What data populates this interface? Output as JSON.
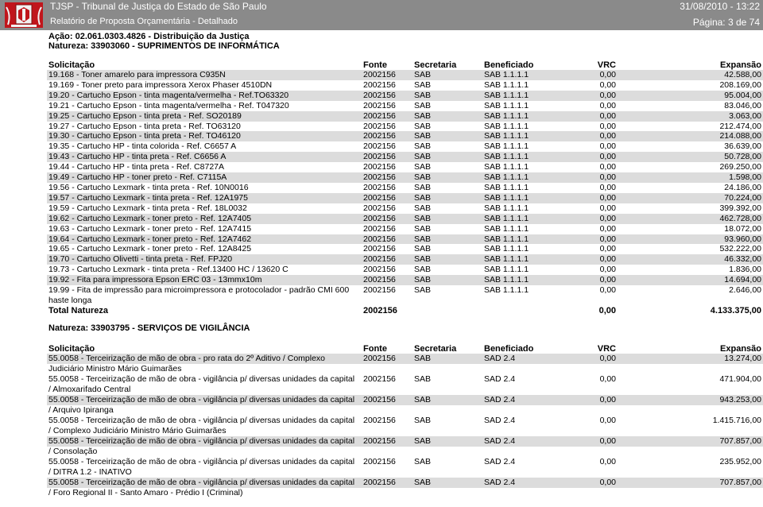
{
  "header": {
    "title": "TJSP - Tribunal de Justiça do Estado de São Paulo",
    "subtitle": "Relatório de Proposta Orçamentária - Detalhado",
    "datetime": "31/08/2010 - 13:22",
    "page": "Página: 3 de 74"
  },
  "acao": "Ação: 02.061.0303.4826 - Distribuição da Justiça",
  "section1": {
    "natureza": "Natureza: 33903060 - SUPRIMENTOS DE INFORMÁTICA",
    "columns": [
      "Solicitação",
      "Fonte",
      "Secretaria",
      "Beneficiado",
      "VRC",
      "Expansão"
    ],
    "rows": [
      [
        "19.168 - Toner amarelo para impressora C935N",
        "2002156",
        "SAB",
        "SAB 1.1.1.1",
        "0,00",
        "42.588,00"
      ],
      [
        "19.169 - Toner preto para impressora Xerox Phaser 4510DN",
        "2002156",
        "SAB",
        "SAB 1.1.1.1",
        "0,00",
        "208.169,00"
      ],
      [
        "19.20 - Cartucho Epson - tinta magenta/vermelha - Ref.TO63320",
        "2002156",
        "SAB",
        "SAB 1.1.1.1",
        "0,00",
        "95.004,00"
      ],
      [
        "19.21 - Cartucho Epson - tinta magenta/vermelha - Ref. T047320",
        "2002156",
        "SAB",
        "SAB 1.1.1.1",
        "0,00",
        "83.046,00"
      ],
      [
        "19.25 - Cartucho Epson - tinta preta - Ref. SO20189",
        "2002156",
        "SAB",
        "SAB 1.1.1.1",
        "0,00",
        "3.063,00"
      ],
      [
        "19.27 - Cartucho Epson - tinta preta - Ref. TO63120",
        "2002156",
        "SAB",
        "SAB 1.1.1.1",
        "0,00",
        "212.474,00"
      ],
      [
        "19.30 - Cartucho Epson - tinta preta - Ref. TO46120",
        "2002156",
        "SAB",
        "SAB 1.1.1.1",
        "0,00",
        "214.088,00"
      ],
      [
        "19.35 - Cartucho HP - tinta colorida - Ref. C6657 A",
        "2002156",
        "SAB",
        "SAB 1.1.1.1",
        "0,00",
        "36.639,00"
      ],
      [
        "19.43 - Cartucho HP - tinta preta - Ref. C6656 A",
        "2002156",
        "SAB",
        "SAB 1.1.1.1",
        "0,00",
        "50.728,00"
      ],
      [
        "19.44 - Cartucho HP - tinta preta - Ref. C8727A",
        "2002156",
        "SAB",
        "SAB 1.1.1.1",
        "0,00",
        "269.250,00"
      ],
      [
        "19.49 - Cartucho HP - toner preto - Ref. C7115A",
        "2002156",
        "SAB",
        "SAB 1.1.1.1",
        "0,00",
        "1.598,00"
      ],
      [
        "19.56 - Cartucho Lexmark - tinta preta - Ref. 10N0016",
        "2002156",
        "SAB",
        "SAB 1.1.1.1",
        "0,00",
        "24.186,00"
      ],
      [
        "19.57 - Cartucho Lexmark - tinta preta - Ref. 12A1975",
        "2002156",
        "SAB",
        "SAB 1.1.1.1",
        "0,00",
        "70.224,00"
      ],
      [
        "19.59 - Cartucho Lexmark - tinta preta - Ref. 18L0032",
        "2002156",
        "SAB",
        "SAB 1.1.1.1",
        "0,00",
        "399.392,00"
      ],
      [
        "19.62 - Cartucho Lexmark - toner preto - Ref. 12A7405",
        "2002156",
        "SAB",
        "SAB 1.1.1.1",
        "0,00",
        "462.728,00"
      ],
      [
        "19.63 - Cartucho Lexmark - toner preto - Ref. 12A7415",
        "2002156",
        "SAB",
        "SAB 1.1.1.1",
        "0,00",
        "18.072,00"
      ],
      [
        "19.64 - Cartucho Lexmark - toner preto - Ref. 12A7462",
        "2002156",
        "SAB",
        "SAB 1.1.1.1",
        "0,00",
        "93.960,00"
      ],
      [
        "19.65 - Cartucho Lexmark - toner preto - Ref. 12A8425",
        "2002156",
        "SAB",
        "SAB 1.1.1.1",
        "0,00",
        "532.222,00"
      ],
      [
        "19.70 - Cartucho Olivetti - tinta preta - Ref. FPJ20",
        "2002156",
        "SAB",
        "SAB 1.1.1.1",
        "0,00",
        "46.332,00"
      ],
      [
        "19.73 - Cartucho Lexmark - tinta preta - Ref.13400 HC / 13620 C",
        "2002156",
        "SAB",
        "SAB 1.1.1.1",
        "0,00",
        "1.836,00"
      ],
      [
        "19.92 - Fita para impressora Epson ERC 03 - 13mmx10m",
        "2002156",
        "SAB",
        "SAB 1.1.1.1",
        "0,00",
        "14.694,00"
      ],
      [
        "19.99 - Fita de impressão para microimpressora e protocolador - padrão CMI 600",
        "2002156",
        "SAB",
        "SAB 1.1.1.1",
        "0,00",
        "2.646,00"
      ]
    ],
    "last_row_cont": "haste longa",
    "total": [
      "Total Natureza",
      "2002156",
      "",
      "",
      "0,00",
      "4.133.375,00"
    ]
  },
  "section2": {
    "natureza": "Natureza: 33903795 - SERVIÇOS DE VIGILÂNCIA",
    "columns": [
      "Solicitação",
      "Fonte",
      "Secretaria",
      "Beneficiado",
      "VRC",
      "Expansão"
    ],
    "rows": [
      [
        "55.0058 - Terceirização de mão de obra - pro rata do 2º Aditivo / Complexo",
        "Judiciário Ministro Mário Guimarães",
        "2002156",
        "SAB",
        "SAD 2.4",
        "0,00",
        "13.274,00"
      ],
      [
        "55.0058 - Terceirização de mão de obra - vigilância p/ diversas unidades da capital",
        "/ Almoxarifado Central",
        "2002156",
        "SAB",
        "SAD 2.4",
        "0,00",
        "471.904,00"
      ],
      [
        "55.0058 - Terceirização de mão de obra - vigilância p/ diversas unidades da capital",
        "/ Arquivo Ipiranga",
        "2002156",
        "SAB",
        "SAD 2.4",
        "0,00",
        "943.253,00"
      ],
      [
        "55.0058 - Terceirização de mão de obra - vigilância p/ diversas unidades da capital",
        "/ Complexo Judiciário Ministro Mário Guimarães",
        "2002156",
        "SAB",
        "SAD 2.4",
        "0,00",
        "1.415.716,00"
      ],
      [
        "55.0058 - Terceirização de mão de obra - vigilância p/ diversas unidades da capital",
        "/ Consolação",
        "2002156",
        "SAB",
        "SAD 2.4",
        "0,00",
        "707.857,00"
      ],
      [
        "55.0058 - Terceirização de mão de obra - vigilância p/ diversas unidades da capital",
        "/ DITRA 1.2 - INATIVO",
        "2002156",
        "SAB",
        "SAD 2.4",
        "0,00",
        "235.952,00"
      ],
      [
        "55.0058 - Terceirização de mão de obra - vigilância p/ diversas unidades da capital",
        "/ Foro Regional II - Santo Amaro - Prédio I (Criminal)",
        "2002156",
        "SAB",
        "SAD 2.4",
        "0,00",
        "707.857,00"
      ]
    ]
  },
  "colors": {
    "header_bg": "#8a8a8a",
    "stripe": "#dcdcdc",
    "logo_red": "#c0161c"
  }
}
